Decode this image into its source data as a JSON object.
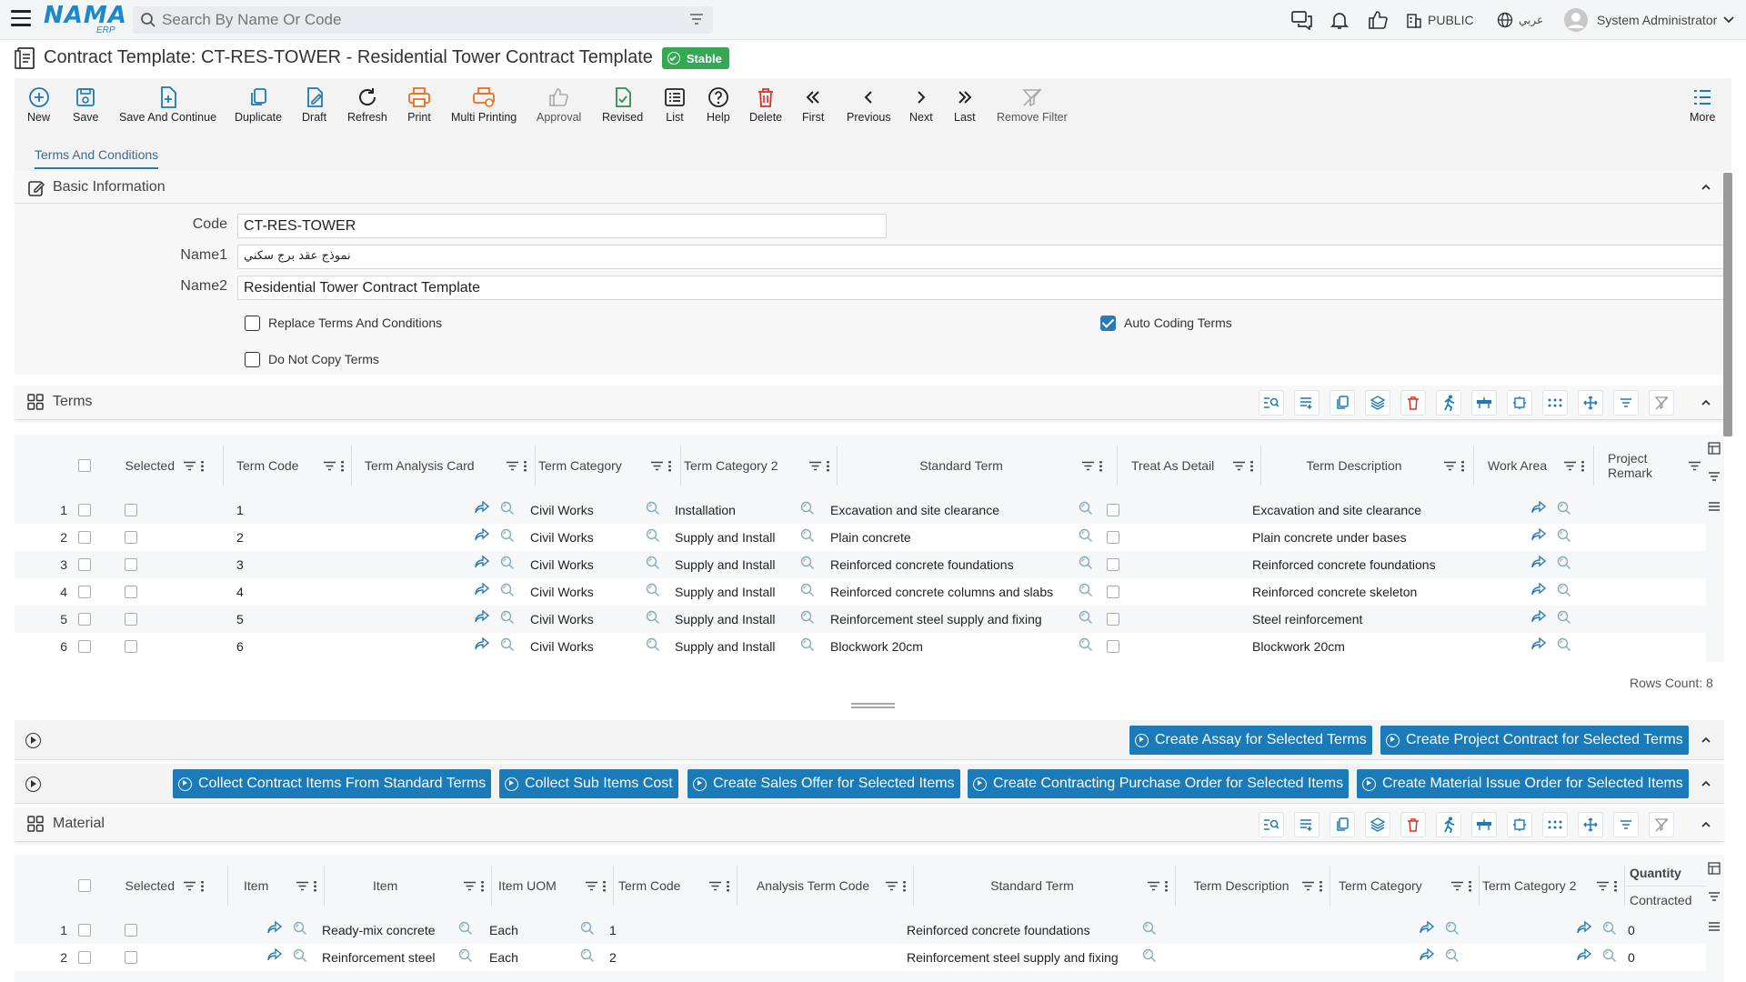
{
  "app": {
    "logo": "NAMA",
    "logo_sub": "ERP"
  },
  "search": {
    "placeholder": "Search By Name Or Code"
  },
  "topbar": {
    "branch": "PUBLIC",
    "language": "عربي",
    "user": "System Administrator"
  },
  "page": {
    "title": "Contract Template: CT-RES-TOWER - Residential Tower Contract Template",
    "status": "Stable"
  },
  "toolbar": {
    "buttons": [
      "New",
      "Save",
      "Save And Continue",
      "Duplicate",
      "Draft",
      "Refresh",
      "Print",
      "Multi Printing",
      "Approval",
      "Revised",
      "List",
      "Help",
      "Delete",
      "First",
      "Previous",
      "Next",
      "Last",
      "Remove Filter",
      "More"
    ]
  },
  "tabs": [
    "Terms And Conditions"
  ],
  "colors": {
    "primary": "#1b7ab8",
    "status_green": "#34a853",
    "orange": "#e8711a",
    "delete_red": "#d93025"
  },
  "basic_info": {
    "header": "Basic Information",
    "code_label": "Code",
    "code": "CT-RES-TOWER",
    "name1_label": "Name1",
    "name1": "نموذج عقد برج سكني",
    "name2_label": "Name2",
    "name2": "Residential Tower Contract Template",
    "replace_terms": "Replace Terms And Conditions",
    "auto_coding": "Auto Coding Terms",
    "do_not_copy": "Do Not Copy Terms"
  },
  "terms": {
    "header": "Terms",
    "columns": [
      "Selected",
      "Term Code",
      "Term Analysis Card",
      "Term Category",
      "Term Category 2",
      "Standard Term",
      "Treat As Detail",
      "Term Description",
      "Work Area",
      "Project Remark"
    ],
    "rows": [
      {
        "n": "1",
        "code": "1",
        "cat": "Civil Works",
        "cat2": "Installation",
        "std": "Excavation and site clearance",
        "desc": "Excavation and site clearance"
      },
      {
        "n": "2",
        "code": "2",
        "cat": "Civil Works",
        "cat2": "Supply and Install",
        "std": "Plain concrete",
        "desc": "Plain concrete under bases"
      },
      {
        "n": "3",
        "code": "3",
        "cat": "Civil Works",
        "cat2": "Supply and Install",
        "std": "Reinforced concrete foundations",
        "desc": "Reinforced concrete foundations"
      },
      {
        "n": "4",
        "code": "4",
        "cat": "Civil Works",
        "cat2": "Supply and Install",
        "std": "Reinforced concrete columns and slabs",
        "desc": "Reinforced concrete skeleton"
      },
      {
        "n": "5",
        "code": "5",
        "cat": "Civil Works",
        "cat2": "Supply and Install",
        "std": "Reinforcement steel supply and fixing",
        "desc": "Steel reinforcement"
      },
      {
        "n": "6",
        "code": "6",
        "cat": "Civil Works",
        "cat2": "Supply and Install",
        "std": "Blockwork 20cm",
        "desc": "Blockwork 20cm"
      }
    ],
    "rows_count": "Rows Count: 8"
  },
  "actions_1": [
    "Create Assay for Selected Terms",
    "Create Project Contract for Selected Terms"
  ],
  "actions_2": [
    "Collect Contract Items From Standard Terms",
    "Collect Sub Items Cost",
    "Create Sales Offer for Selected Items",
    "Create Contracting Purchase Order for Selected Items",
    "Create Material Issue Order for Selected Items"
  ],
  "material": {
    "header": "Material",
    "columns": [
      "Selected",
      "Item",
      "Item",
      "Item UOM",
      "Term Code",
      "Analysis Term Code",
      "Standard Term",
      "Term Description",
      "Term Category",
      "Term Category 2",
      "Quantity",
      "Contracted"
    ],
    "rows": [
      {
        "n": "1",
        "item": "Ready-mix concrete",
        "uom": "Each",
        "code": "1",
        "std": "Reinforced concrete foundations",
        "qty": "0"
      },
      {
        "n": "2",
        "item": "Reinforcement steel",
        "uom": "Each",
        "code": "2",
        "std": "Reinforcement steel supply and fixing",
        "qty": "0"
      }
    ]
  }
}
